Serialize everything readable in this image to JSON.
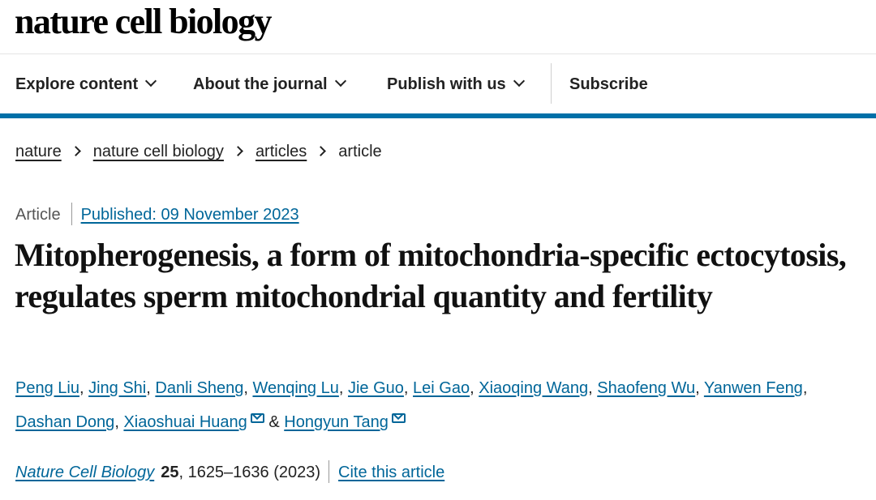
{
  "site": {
    "logo": "nature cell biology"
  },
  "nav": [
    {
      "label": "Explore content"
    },
    {
      "label": "About the journal"
    },
    {
      "label": "Publish with us"
    },
    {
      "label": "Subscribe"
    }
  ],
  "breadcrumb": [
    {
      "label": "nature"
    },
    {
      "label": "nature cell biology"
    },
    {
      "label": "articles"
    },
    {
      "label": "article"
    }
  ],
  "article": {
    "type": "Article",
    "published": "Published: 09 November 2023",
    "title": "Mitopherogenesis, a form of mitochondria-specific ectocytosis, regulates sperm mitochondrial quantity and fertility",
    "authors": [
      "Peng Liu",
      "Jing Shi",
      "Danli Sheng",
      "Wenqing Lu",
      "Jie Guo",
      "Lei Gao",
      "Xiaoqing Wang",
      "Shaofeng Wu",
      "Yanwen Feng",
      "Dashan Dong",
      "Xiaoshuai Huang",
      "Hongyun Tang"
    ],
    "author_sep": ",",
    "author_and": "&",
    "journal": "Nature Cell Biology",
    "volume": "25",
    "pages_year": ", 1625–1636 (2023)",
    "cite_label": "Cite this article"
  },
  "colors": {
    "link": "#006699",
    "accent_bar": "#0070a8"
  },
  "icons": {
    "email": "mail-icon",
    "dropdown": "chevron-down-icon",
    "breadcrumb_sep": "chevron-right-icon"
  }
}
